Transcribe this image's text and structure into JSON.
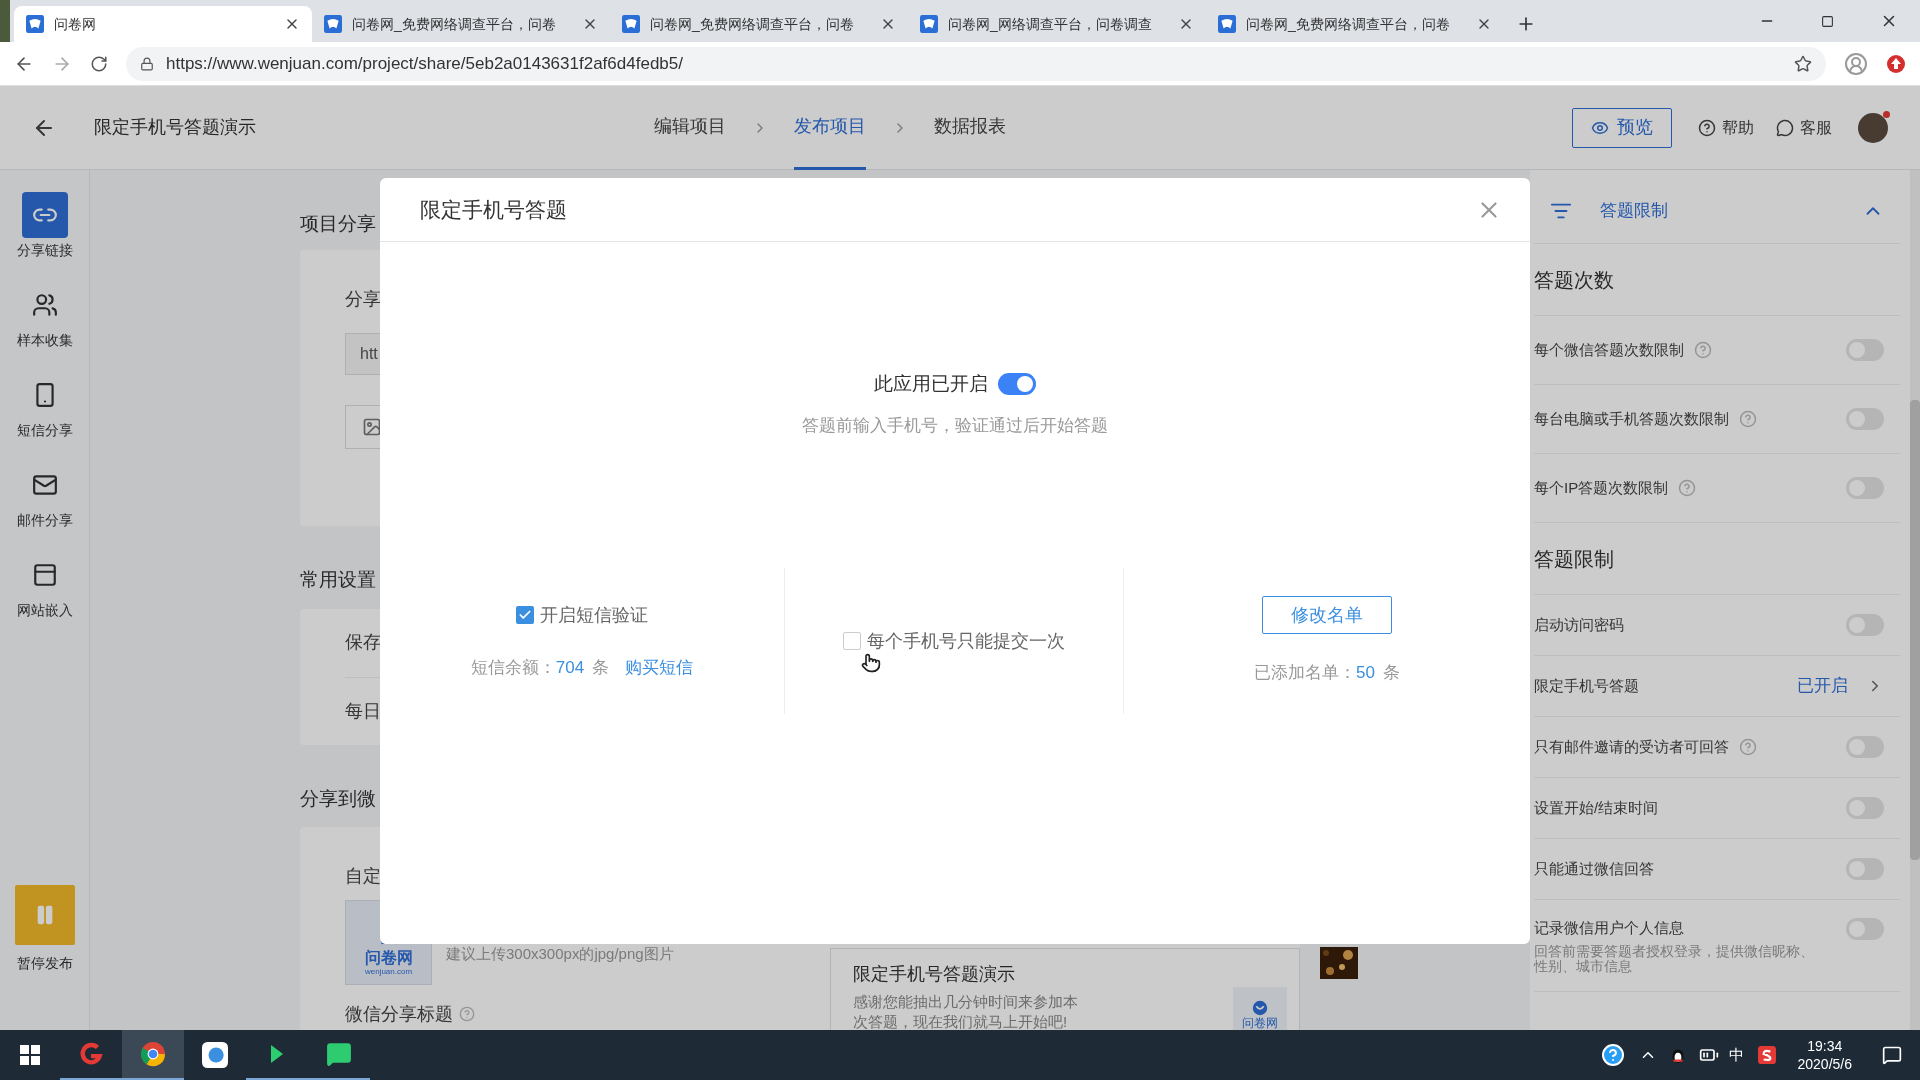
{
  "browser": {
    "tabs": [
      {
        "title": "问卷网",
        "selected": true
      },
      {
        "title": "问卷网_免费网络调查平台，问卷",
        "selected": false
      },
      {
        "title": "问卷网_免费网络调查平台，问卷",
        "selected": false
      },
      {
        "title": "问卷网_网络调查平台，问卷调查",
        "selected": false
      },
      {
        "title": "问卷网_免费网络调查平台，问卷",
        "selected": false
      }
    ],
    "url": "https://www.wenjuan.com/project/share/5eb2a0143631f2af6d4fedb5/"
  },
  "app_header": {
    "title": "限定手机号答题演示",
    "steps": [
      {
        "label": "编辑项目",
        "selected": false
      },
      {
        "label": "发布项目",
        "selected": true
      },
      {
        "label": "数据报表",
        "selected": false
      }
    ],
    "preview_button": "预览",
    "help": "帮助",
    "service": "客服"
  },
  "sidebar": {
    "items": [
      {
        "label": "分享链接",
        "selected": true
      },
      {
        "label": "样本收集",
        "selected": false
      },
      {
        "label": "短信分享",
        "selected": false
      },
      {
        "label": "邮件分享",
        "selected": false
      },
      {
        "label": "网站嵌入",
        "selected": false
      }
    ],
    "pause_button": "暂停发布"
  },
  "background": {
    "share_title": "项目分享",
    "share_label": "分享",
    "link_field": "htt",
    "common_title": "常用设置",
    "common_rows": [
      "保存",
      "每日"
    ],
    "wechat_title": "分享到微",
    "custom_label": "自定",
    "logo_text": "问卷网",
    "logo_domain": "wenjuan.com",
    "logo_hint": "建议上传300x300px的jpg/png图片",
    "wechat_title_label": "微信分享标题",
    "preview": {
      "title": "限定手机号答题演示",
      "lines": [
        "感谢您能抽出几分钟时间来参加本",
        "次答题，现在我们就马上开始吧!"
      ],
      "logo_text": "问卷网"
    }
  },
  "modal": {
    "title": "限定手机号答题",
    "status_label": "此应用已开启",
    "on": true,
    "description": "答题前输入手机号，验证通过后开始答题",
    "columns": [
      {
        "kind": "checkbox",
        "label": "开启短信验证",
        "checked": true,
        "info_label": "短信余额：",
        "info_value": "704",
        "info_unit": "条",
        "link": "购买短信"
      },
      {
        "kind": "checkbox",
        "label": "每个手机号只能提交一次",
        "checked": false
      },
      {
        "kind": "button",
        "button": "修改名单",
        "info_label": "已添加名单：",
        "info_value": "50",
        "info_unit": "条"
      }
    ]
  },
  "right_panel": {
    "title": "答题限制",
    "expanded": true,
    "sections": [
      {
        "heading": "答题次数",
        "rows": [
          {
            "kind": "toggle",
            "label": "每个微信答题次数限制",
            "help": true,
            "on": false
          },
          {
            "kind": "toggle",
            "label": "每台电脑或手机答题次数限制",
            "help": true,
            "on": false
          },
          {
            "kind": "toggle",
            "label": "每个IP答题次数限制",
            "help": true,
            "on": false
          }
        ]
      },
      {
        "heading": "答题限制",
        "rows": [
          {
            "kind": "toggle",
            "label": "启动访问密码",
            "help": false,
            "on": false
          },
          {
            "kind": "link",
            "label": "限定手机号答题",
            "status": "已开启"
          },
          {
            "kind": "toggle",
            "label": "只有邮件邀请的受访者可回答",
            "help": true,
            "on": false
          },
          {
            "kind": "toggle",
            "label": "设置开始/结束时间",
            "help": false,
            "on": false
          },
          {
            "kind": "toggle",
            "label": "只能通过微信回答",
            "help": false,
            "on": false
          },
          {
            "kind": "toggle",
            "label": "记录微信用户个人信息",
            "help": false,
            "on": false,
            "description": "回答前需要答题者授权登录，提供微信昵称、性别、城市信息"
          }
        ]
      }
    ]
  },
  "taskbar": {
    "ime": "中",
    "time": "19:34",
    "date": "2020/5/6"
  }
}
